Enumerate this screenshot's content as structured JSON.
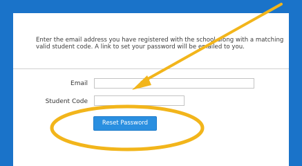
{
  "form": {
    "intro_text": "Enter the email address you have registered with the school along with a matching valid student code. A link to set your password will be emailed to you.",
    "email_label": "Email",
    "email_value": "",
    "student_code_label": "Student Code",
    "student_code_value": "",
    "submit_label": "Reset Password"
  },
  "colors": {
    "page_background": "#1a73c9",
    "button": "#2a8fe0",
    "annotation": "#f2b51b"
  },
  "annotation": {
    "arrow_icon": "arrow-icon",
    "highlight_icon": "ellipse-highlight-icon"
  }
}
